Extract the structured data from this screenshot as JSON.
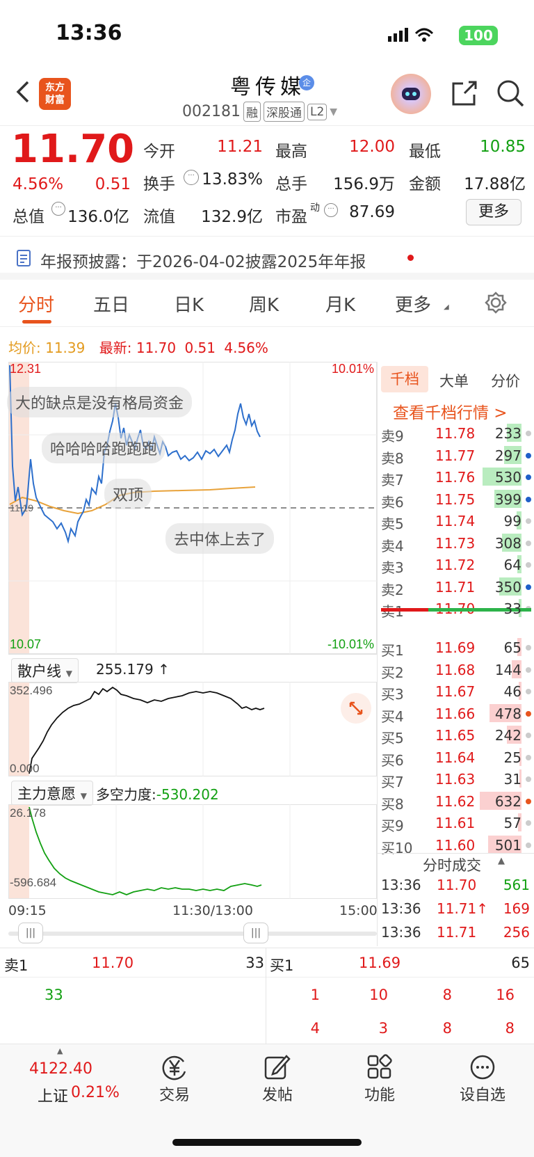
{
  "status": {
    "time": "13:36",
    "battery": "100"
  },
  "header": {
    "title": "粤传媒",
    "code": "002181",
    "tags": [
      "融",
      "深股通",
      "L2"
    ],
    "logo": "东方财富"
  },
  "quote": {
    "price": "11.70",
    "change_pct": "4.56%",
    "change": "0.51",
    "open_label": "今开",
    "open": "11.21",
    "high_label": "最高",
    "high": "12.00",
    "low_label": "最低",
    "low": "10.85",
    "turnover_label": "换手",
    "turnover": "13.83%",
    "volume_label": "总手",
    "volume": "156.9万",
    "amount_label": "金额",
    "amount": "17.88亿",
    "mktcap_label": "总值",
    "mktcap": "136.0亿",
    "float_label": "流值",
    "float": "132.9亿",
    "pe_label": "市盈",
    "pe_sup": "动",
    "pe": "87.69",
    "more": "更多"
  },
  "notice": "年报预披露：于2026-04-02披露2025年年报",
  "tabs": [
    "分时",
    "五日",
    "日K",
    "周K",
    "月K",
    "更多"
  ],
  "infoline": {
    "avg_label": "均价:",
    "avg": "11.39",
    "latest_label": "最新:",
    "latest": "11.70",
    "chg": "0.51",
    "pct": "4.56%"
  },
  "chart": {
    "y_top": "12.31",
    "y_mid": "11.19",
    "y_bottom": "10.07",
    "pct_top": "10.01%",
    "pct_bottom": "-10.01%",
    "comments": [
      "大的缺点是没有格局资金",
      "哈哈哈哈跑跑跑",
      "双顶",
      "去中体上去了"
    ],
    "retail_label": "散户线",
    "retail_value": "255.179 ↑",
    "retail_top": "352.496",
    "retail_bottom": "0.000",
    "main_label": "主力意愿",
    "main_force_label": "多空力度:",
    "main_force": "-530.202",
    "main_top": "26.178",
    "main_bottom": "-596.684",
    "t_start": "09:15",
    "t_mid": "11:30/13:00",
    "t_end": "15:00"
  },
  "orderbook": {
    "tabs": [
      "千档",
      "大单",
      "分价"
    ],
    "link": "查看千档行情 >",
    "asks": [
      {
        "label": "卖9",
        "price": "11.78",
        "vol": "233",
        "bar": 0.3,
        "dot": "#ccc"
      },
      {
        "label": "卖8",
        "price": "11.77",
        "vol": "297",
        "bar": 0.35,
        "dot": "#1f5fc9"
      },
      {
        "label": "卖7",
        "price": "11.76",
        "vol": "530",
        "bar": 0.8,
        "dot": "#1f5fc9"
      },
      {
        "label": "卖6",
        "price": "11.75",
        "vol": "399",
        "bar": 0.55,
        "dot": "#1f5fc9"
      },
      {
        "label": "卖5",
        "price": "11.74",
        "vol": "99",
        "bar": 0.1,
        "dot": "#ccc"
      },
      {
        "label": "卖4",
        "price": "11.73",
        "vol": "308",
        "bar": 0.4,
        "dot": "#ccc"
      },
      {
        "label": "卖3",
        "price": "11.72",
        "vol": "64",
        "bar": 0.08,
        "dot": "#ccc"
      },
      {
        "label": "卖2",
        "price": "11.71",
        "vol": "350",
        "bar": 0.45,
        "dot": "#1f5fc9"
      },
      {
        "label": "卖1",
        "price": "11.70",
        "vol": "33",
        "bar": 0.05,
        "dot": "#ccc"
      }
    ],
    "bids": [
      {
        "label": "买1",
        "price": "11.69",
        "vol": "65",
        "bar": 0.08,
        "dot": "#ccc"
      },
      {
        "label": "买2",
        "price": "11.68",
        "vol": "144",
        "bar": 0.2,
        "dot": "#ccc"
      },
      {
        "label": "买3",
        "price": "11.67",
        "vol": "46",
        "bar": 0.06,
        "dot": "#ccc"
      },
      {
        "label": "买4",
        "price": "11.66",
        "vol": "478",
        "bar": 0.65,
        "dot": "#e8541d"
      },
      {
        "label": "买5",
        "price": "11.65",
        "vol": "242",
        "bar": 0.3,
        "dot": "#ccc"
      },
      {
        "label": "买6",
        "price": "11.64",
        "vol": "25",
        "bar": 0.04,
        "dot": "#ccc"
      },
      {
        "label": "买7",
        "price": "11.63",
        "vol": "31",
        "bar": 0.04,
        "dot": "#ccc"
      },
      {
        "label": "买8",
        "price": "11.62",
        "vol": "632",
        "bar": 0.85,
        "dot": "#e8541d"
      },
      {
        "label": "买9",
        "price": "11.61",
        "vol": "57",
        "bar": 0.07,
        "dot": "#ccc"
      },
      {
        "label": "买10",
        "price": "11.60",
        "vol": "501",
        "bar": 0.68,
        "dot": "#ccc"
      }
    ],
    "ticks_title": "分时成交",
    "ticks": [
      {
        "t": "13:36",
        "p": "11.70",
        "v": "561",
        "vc": "#12a012"
      },
      {
        "t": "13:36",
        "p": "11.71↑",
        "v": "169",
        "vc": "#e0191a"
      },
      {
        "t": "13:36",
        "p": "11.71",
        "v": "256",
        "vc": "#e0191a"
      }
    ]
  },
  "level2": {
    "ask_label": "卖1",
    "ask_price": "11.70",
    "ask_vol": "33",
    "ask_queue": [
      "33"
    ],
    "bid_label": "买1",
    "bid_price": "11.69",
    "bid_vol": "65",
    "bid_queue": [
      "1",
      "10",
      "8",
      "16",
      "4",
      "3",
      "8",
      "8"
    ]
  },
  "bottomnav": {
    "index_value": "4122.40",
    "index_name": "上证",
    "index_pct": "0.21%",
    "items": [
      "交易",
      "发帖",
      "功能",
      "设自选"
    ]
  }
}
